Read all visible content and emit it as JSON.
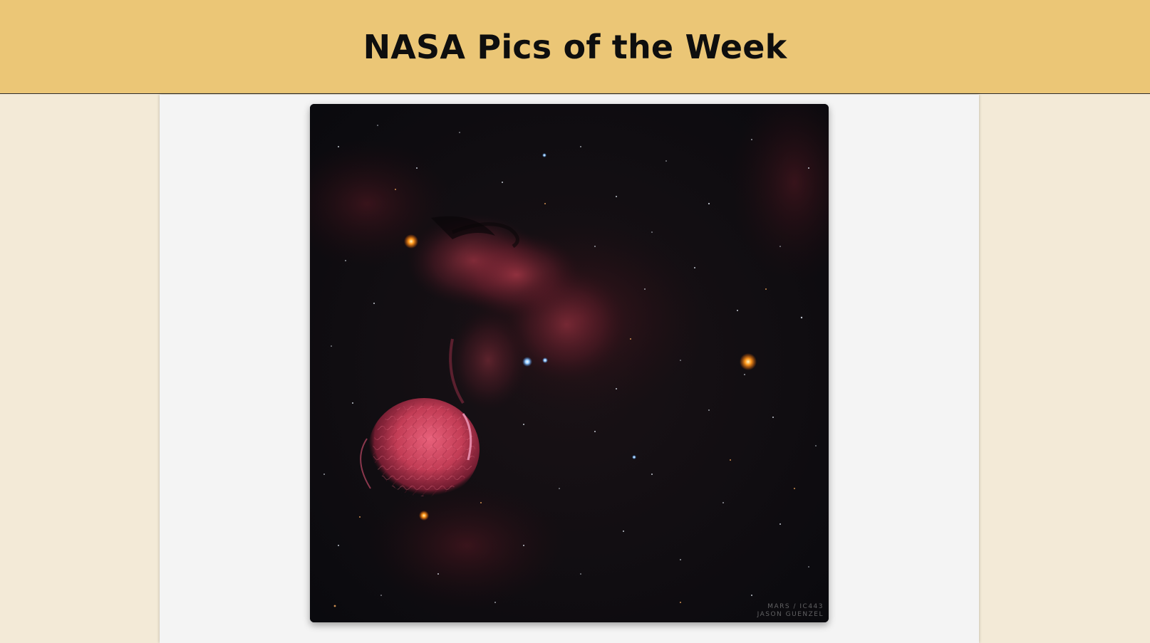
{
  "header": {
    "title": "NASA Pics of the Week",
    "background": "#ebc676"
  },
  "photo": {
    "subject": "IC 443 (Jellyfish Nebula) with Mars",
    "watermark_line1": "MARS / IC443",
    "watermark_line2": "JASON GUENZEL"
  },
  "colors": {
    "page_background": "#f3ead7",
    "panel_background": "#f4f4f4",
    "nebula": "#c94a5a"
  }
}
